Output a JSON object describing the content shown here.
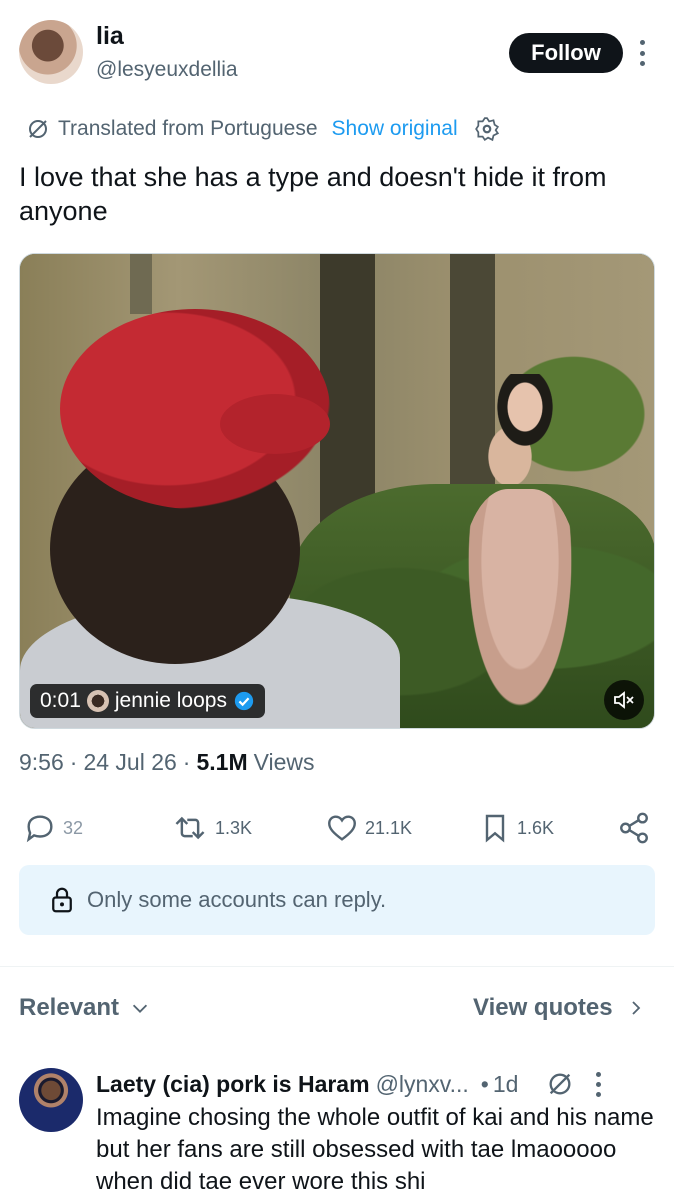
{
  "author": {
    "name": "lia",
    "handle": "@lesyeuxdellia",
    "follow_label": "Follow"
  },
  "translation": {
    "label": "Translated from Portuguese",
    "show_original": "Show original"
  },
  "tweet": {
    "text": "I love that she has a type and doesn't hide it from anyone"
  },
  "video": {
    "timestamp": "0:01",
    "source_name": "jennie loops"
  },
  "meta": {
    "time": "9:56",
    "date": "24 Jul 26",
    "views_count": "5.1M",
    "views_label": "Views"
  },
  "actions": {
    "replies": "32",
    "reposts": "1.3K",
    "likes": "21.1K",
    "bookmarks": "1.6K"
  },
  "reply_restriction": "Only some accounts can reply.",
  "sort": {
    "relevant_label": "Relevant",
    "view_quotes_label": "View quotes"
  },
  "reply": {
    "name": "Laety (cia) pork is Haram",
    "handle": "@lynxv...",
    "time": "1d",
    "text": "Imagine chosing the whole outfit of kai and his name but her fans are still obsessed with tae lmaooooo when did tae ever wore this shi"
  },
  "colors": {
    "accent": "#1d9bf0",
    "text_primary": "#0f1419",
    "text_secondary": "#536471",
    "reply_box_bg": "#e8f5fd"
  }
}
